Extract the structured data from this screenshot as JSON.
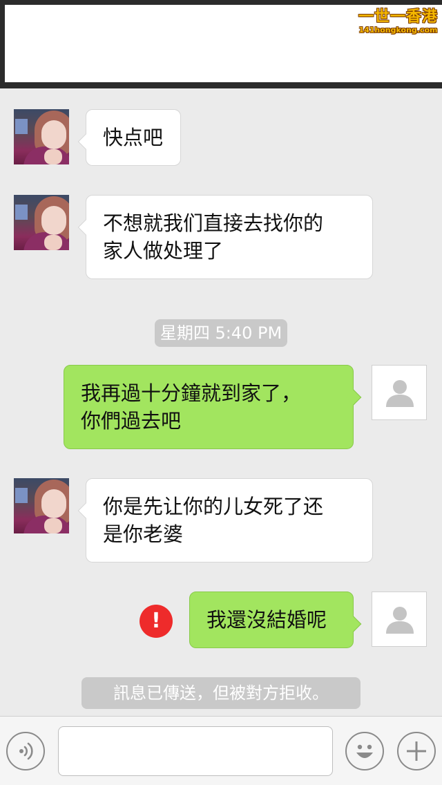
{
  "watermark": {
    "title": "一世一香港",
    "subtitle": "141hongkong.com"
  },
  "messages": [
    {
      "id": "m1",
      "direction": "incoming",
      "text": "快点吧"
    },
    {
      "id": "m2",
      "direction": "incoming",
      "text": "不想就我们直接去找你的\n家人做处理了"
    },
    {
      "id": "m3",
      "direction": "outgoing",
      "text": "我再過十分鐘就到家了，\n你們過去吧"
    },
    {
      "id": "m4",
      "direction": "incoming",
      "text": "你是先让你的儿女死了还\n是你老婆"
    },
    {
      "id": "m5",
      "direction": "outgoing",
      "text": "我還沒結婚呢",
      "status": "failed"
    }
  ],
  "timestamp": "星期四 5:40 PM",
  "error_icon": "!",
  "system_notice": "訊息已傳送，但被對方拒收。",
  "input": {
    "value": "",
    "placeholder": ""
  },
  "icons": {
    "voice": "voice-icon",
    "emoji": "emoji-icon",
    "add": "plus-icon",
    "default_avatar": "person-silhouette-icon",
    "error": "exclamation-icon"
  },
  "colors": {
    "outgoing_bubble": "#a2e55f",
    "incoming_bubble": "#ffffff",
    "background": "#ebebeb",
    "error": "#ee2b2b",
    "pill": "#c9c9c9"
  }
}
